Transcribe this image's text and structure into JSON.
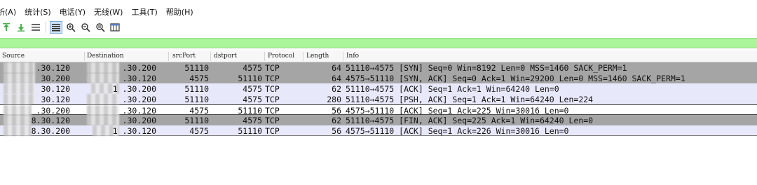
{
  "menu": [
    "析(A)",
    "统计(S)",
    "电话(Y)",
    "无线(W)",
    "工具(T)",
    "帮助(H)"
  ],
  "toolbar": {
    "icons": [
      "go-first-icon",
      "go-last-icon",
      "autoscroll-icon",
      "colorize-icon",
      "zoom-in-icon",
      "zoom-out-icon",
      "zoom-reset-icon",
      "resize-columns-icon"
    ]
  },
  "columns": {
    "source": "Source",
    "destination": "Destination",
    "srcport": "srcPort",
    "dstport": "dstport",
    "protocol": "Protocol",
    "length": "Length",
    "info": "Info"
  },
  "packets": [
    {
      "source": ".30.120",
      "destination": ".30.200",
      "srcport": "51110",
      "dstport": "4575",
      "protocol": "TCP",
      "length": "64",
      "info": "51110→4575 [SYN] Seq=0 Win=8192 Len=0 MSS=1460 SACK_PERM=1",
      "style": "dark"
    },
    {
      "source": "30.200",
      "destination": ".30.120",
      "srcport": "4575",
      "dstport": "51110",
      "protocol": "TCP",
      "length": "64",
      "info": "4575→51110 [SYN, ACK] Seq=0 Ack=1 Win=29200 Len=0 MSS=1460 SACK_PERM=1",
      "style": "dark"
    },
    {
      "source": "30.120",
      "destination": "1 .30.200",
      "srcport": "51110",
      "dstport": "4575",
      "protocol": "TCP",
      "length": "62",
      "info": "51110→4575 [ACK] Seq=1 Ack=1 Win=64240 Len=0",
      "style": "light"
    },
    {
      "source": "30.120",
      "destination": ".30.200",
      "srcport": "51110",
      "dstport": "4575",
      "protocol": "TCP",
      "length": "280",
      "info": "51110→4575 [PSH, ACK] Seq=1 Ack=1 Win=64240 Len=224",
      "style": "light"
    },
    {
      "source": ".30.200",
      "destination": ".30.120",
      "srcport": "4575",
      "dstport": "51110",
      "protocol": "TCP",
      "length": "56",
      "info": "4575→51110 [ACK] Seq=1 Ack=225 Win=30016 Len=0",
      "style": "sel-white"
    },
    {
      "source": "8.30.120",
      "destination": ".30.200",
      "srcport": "51110",
      "dstport": "4575",
      "protocol": "TCP",
      "length": "62",
      "info": "51110→4575 [FIN, ACK] Seq=225 Ack=1 Win=64240 Len=0",
      "style": "dark"
    },
    {
      "source": "8.30.200",
      "destination": "1 .30.120",
      "srcport": "4575",
      "dstport": "51110",
      "protocol": "TCP",
      "length": "56",
      "info": "4575→51110 [ACK] Seq=1 Ack=226 Win=30016 Len=0",
      "style": "last"
    }
  ]
}
